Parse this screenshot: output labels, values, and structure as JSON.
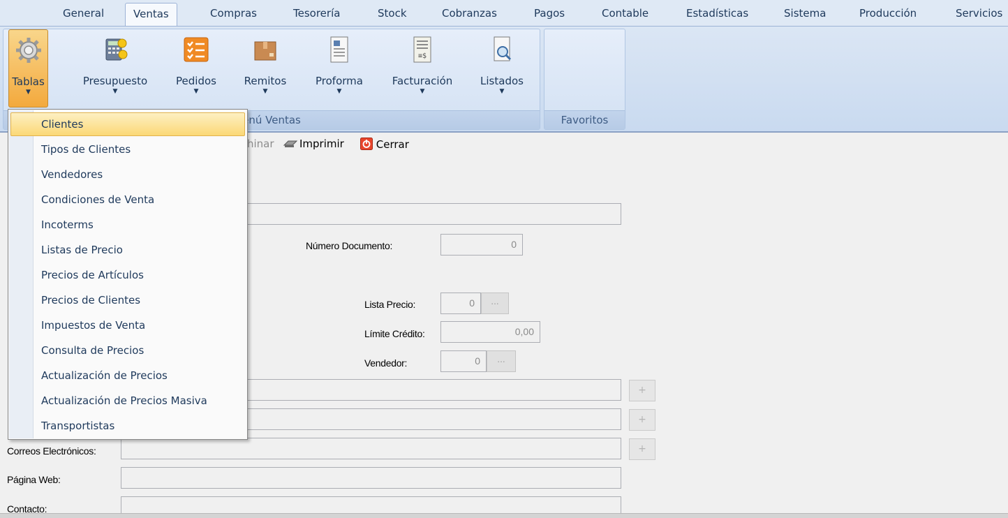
{
  "tabs": [
    "General",
    "Ventas",
    "Compras",
    "Tesorería",
    "Stock",
    "Cobranzas",
    "Pagos",
    "Contable",
    "Estadísticas",
    "Sistema",
    "Producción",
    "Servicios"
  ],
  "ribbon": {
    "buttons": [
      "Tablas",
      "Presupuesto",
      "Pedidos",
      "Remitos",
      "Proforma",
      "Facturación",
      "Listados"
    ],
    "group_main": "enú Ventas",
    "group_fav": "Favoritos"
  },
  "toolbar": {
    "eliminar_partial": "hinar",
    "imprimir": "Imprimir",
    "cerrar": "Cerrar"
  },
  "menu": {
    "items": [
      "Clientes",
      "Tipos de Clientes",
      "Vendedores",
      "Condiciones de Venta",
      "Incoterms",
      "Listas de Precio",
      "Precios de Artículos",
      "Precios de Clientes",
      "Impuestos de Venta",
      "Consulta de Precios",
      "Actualización de Precios",
      "Actualización de Precios Masiva",
      "Transportistas"
    ]
  },
  "form": {
    "numero_documento_label": "Número Documento:",
    "numero_documento_value": "0",
    "lista_precio_label": "Lista Precio:",
    "lista_precio_value": "0",
    "limite_credito_label": "Límite Crédito:",
    "limite_credito_value": "0,00",
    "vendedor_label": "Vendedor:",
    "vendedor_value": "0",
    "dots": "...",
    "plus": "+",
    "correos_label": "Correos Electrónicos:",
    "pagina_web_label": "Página Web:",
    "contacto_label": "Contacto:"
  },
  "colors": {
    "ribbon_bg": "#dbe6f4",
    "selected_button": "#f3a93d",
    "menu_highlight": "#fbd876"
  }
}
